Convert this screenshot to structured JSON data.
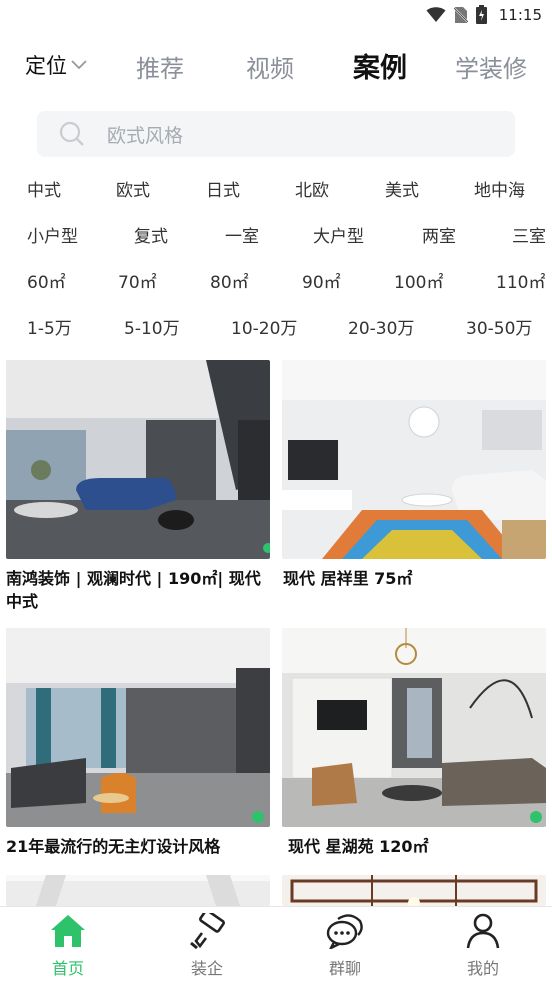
{
  "status": {
    "time": "11:15"
  },
  "nav": {
    "location_label": "定位",
    "tabs": [
      {
        "label": "推荐",
        "active": false
      },
      {
        "label": "视频",
        "active": false
      },
      {
        "label": "案例",
        "active": true
      },
      {
        "label": "学装修",
        "active": false
      }
    ]
  },
  "search": {
    "placeholder": "欧式风格"
  },
  "filters": {
    "styles": [
      "中式",
      "欧式",
      "日式",
      "北欧",
      "美式",
      "地中海"
    ],
    "layouts": [
      "小户型",
      "复式",
      "一室",
      "大户型",
      "两室",
      "三室"
    ],
    "areas": [
      "60㎡",
      "70㎡",
      "80㎡",
      "90㎡",
      "100㎡",
      "110㎡"
    ],
    "budgets": [
      "1-5万",
      "5-10万",
      "10-20万",
      "20-30万",
      "30-50万"
    ]
  },
  "cards": [
    {
      "title": "南鸿装饰 | 观澜时代 | 190㎡| 现代中式",
      "image": "modern-living-room-blue-sofa"
    },
    {
      "title": "现代 居祥里  75㎡",
      "image": "white-living-room-rainbow-rug"
    },
    {
      "title": "21年最流行的无主灯设计风格",
      "image": "living-room-orange-chair"
    },
    {
      "title": "现代 星湖苑 120㎡",
      "image": "marble-living-room-chandelier"
    }
  ],
  "bottom_nav": [
    {
      "label": "首页",
      "icon": "home-icon",
      "active": true
    },
    {
      "label": "装企",
      "icon": "paint-roller-icon",
      "active": false
    },
    {
      "label": "群聊",
      "icon": "chat-bubbles-icon",
      "active": false
    },
    {
      "label": "我的",
      "icon": "user-icon",
      "active": false
    }
  ],
  "colors": {
    "accent": "#2ec26b",
    "tab_inactive": "#8a8f99",
    "search_bg": "#f4f5f6"
  }
}
